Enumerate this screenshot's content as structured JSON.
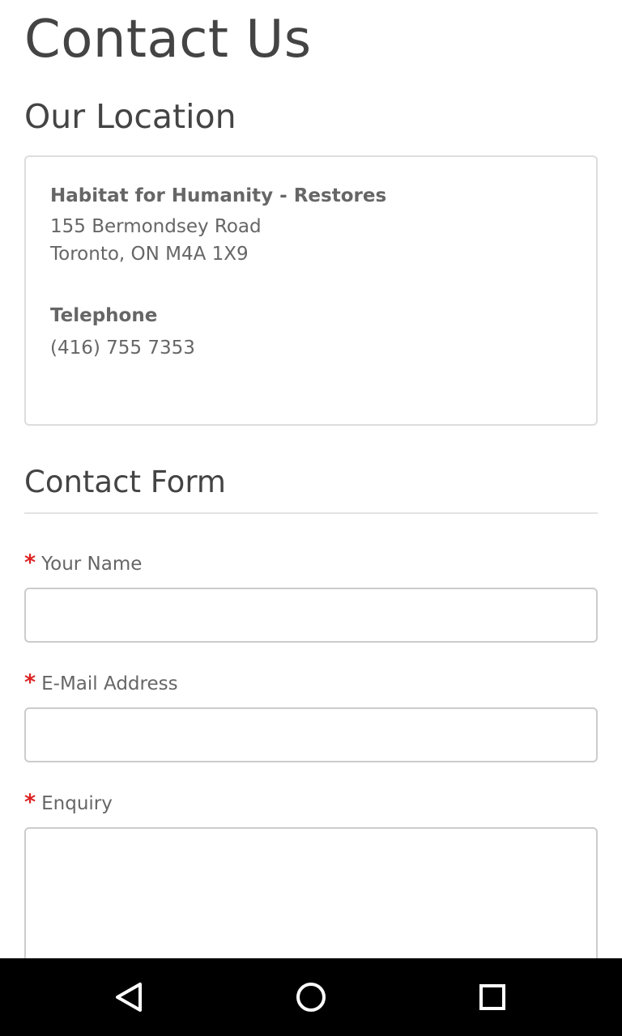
{
  "page": {
    "title": "Contact Us"
  },
  "location": {
    "heading": "Our Location",
    "org_name": "Habitat for Humanity - Restores",
    "address_line1": "155 Bermondsey Road",
    "address_line2": "Toronto, ON M4A 1X9",
    "telephone_label": "Telephone",
    "telephone_value": "(416) 755 7353"
  },
  "form": {
    "heading": "Contact Form",
    "required_marker": "*",
    "fields": {
      "name": {
        "label": "Your Name",
        "value": ""
      },
      "email": {
        "label": "E-Mail Address",
        "value": ""
      },
      "enquiry": {
        "label": "Enquiry",
        "value": ""
      }
    }
  },
  "navbar": {
    "back_icon": "back-triangle-icon",
    "home_icon": "home-circle-icon",
    "recents_icon": "recents-square-icon"
  },
  "colors": {
    "required": "#dd2222",
    "text": "#444444",
    "muted_text": "#666666",
    "border": "#cccccc",
    "navbar": "#000000"
  }
}
